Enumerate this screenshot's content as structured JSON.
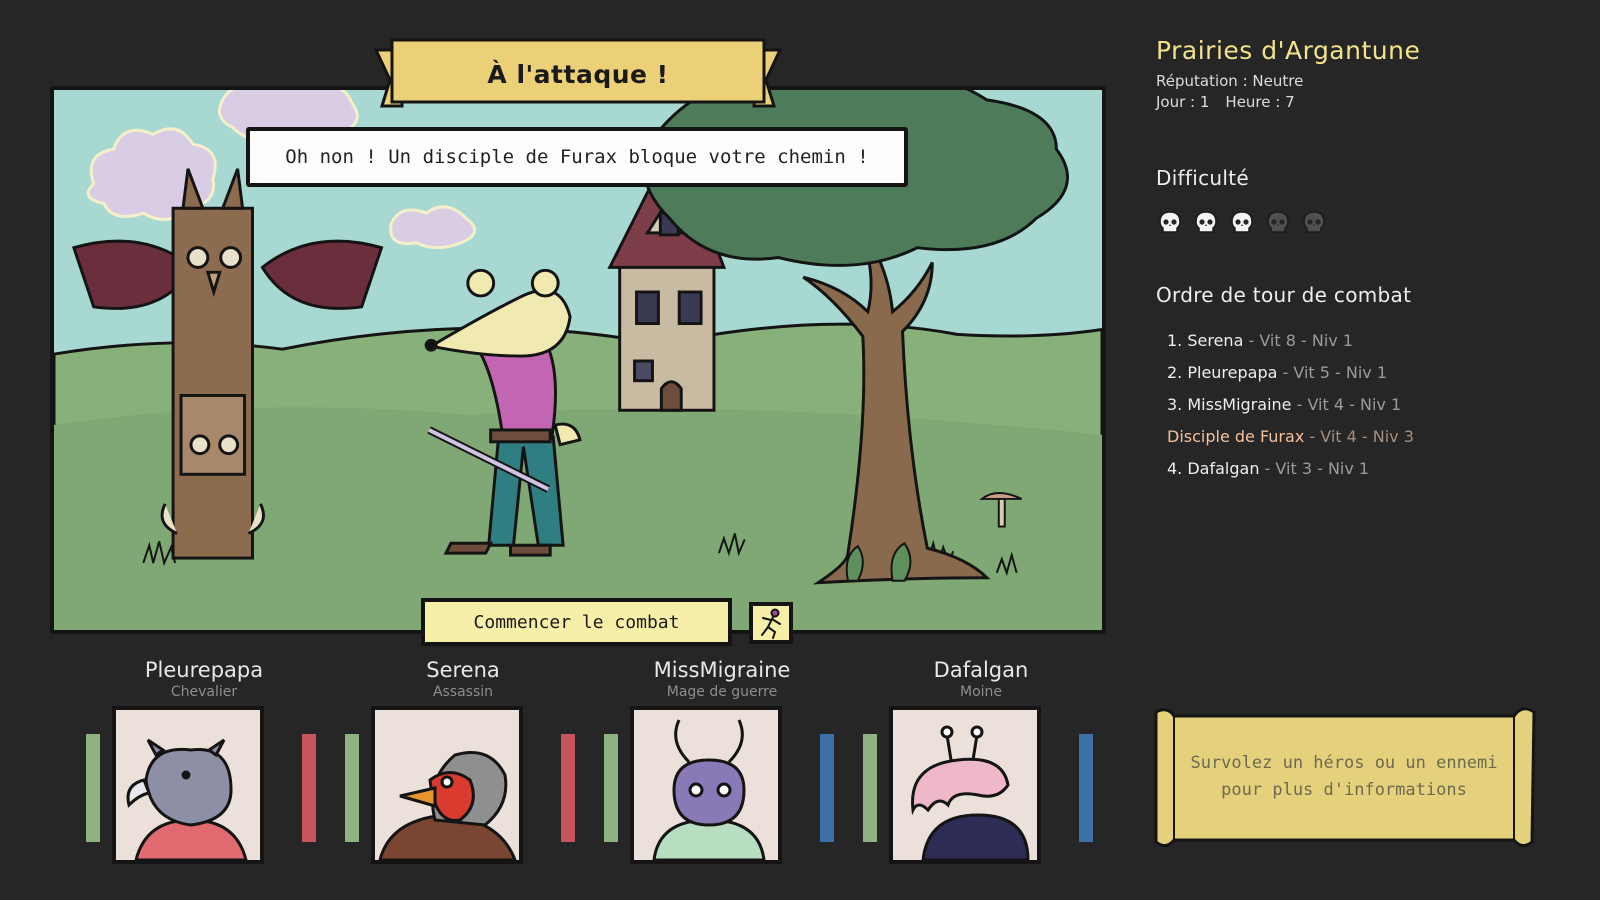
{
  "encounter": {
    "title": "À l'attaque !",
    "dialogue": "Oh non ! Un disciple de Furax bloque votre chemin !",
    "start_button": "Commencer le combat",
    "flee_icon": "running-man-icon"
  },
  "location": {
    "name": "Prairies d'Argantune",
    "reputation": "Réputation : Neutre",
    "day": "Jour : 1",
    "hour": "Heure : 7"
  },
  "difficulty": {
    "title": "Difficulté",
    "level": 3,
    "max": 5,
    "icon": "skull-icon"
  },
  "turn_order": {
    "title": "Ordre de tour de combat",
    "entries": [
      {
        "label": "1. Serena",
        "stats": " - Vit 8 - Niv 1",
        "enemy": false
      },
      {
        "label": "2. Pleurepapa",
        "stats": " - Vit 5 - Niv 1",
        "enemy": false
      },
      {
        "label": "3. MissMigraine",
        "stats": " - Vit 4 - Niv 1",
        "enemy": false
      },
      {
        "label": "Disciple de Furax",
        "stats": " - Vit 4 - Niv 3",
        "enemy": true
      },
      {
        "label": "4. Dafalgan",
        "stats": " - Vit 3 - Niv 1",
        "enemy": false
      }
    ]
  },
  "heroes": [
    {
      "name": "Pleurepapa",
      "class": "Chevalier",
      "portrait": "rhino-knight",
      "hp_color": "#8eb380",
      "resource_color": "#c7555e"
    },
    {
      "name": "Serena",
      "class": "Assassin",
      "portrait": "robin-assassin",
      "hp_color": "#8eb380",
      "resource_color": "#c7555e"
    },
    {
      "name": "MissMigraine",
      "class": "Mage de guerre",
      "portrait": "beetle-mage",
      "hp_color": "#8eb380",
      "resource_color": "#3d6fa8"
    },
    {
      "name": "Dafalgan",
      "class": "Moine",
      "portrait": "slug-monk",
      "hp_color": "#8eb380",
      "resource_color": "#3d6fa8"
    }
  ],
  "info_hint": "Survolez un héros ou un ennemi pour plus d'informations",
  "colors": {
    "background": "#262626",
    "location_title": "#f3e28b",
    "enemy_text": "#f5c09a",
    "banner": "#ecd077",
    "scroll": "#e5d17c",
    "button": "#f6efa8"
  }
}
